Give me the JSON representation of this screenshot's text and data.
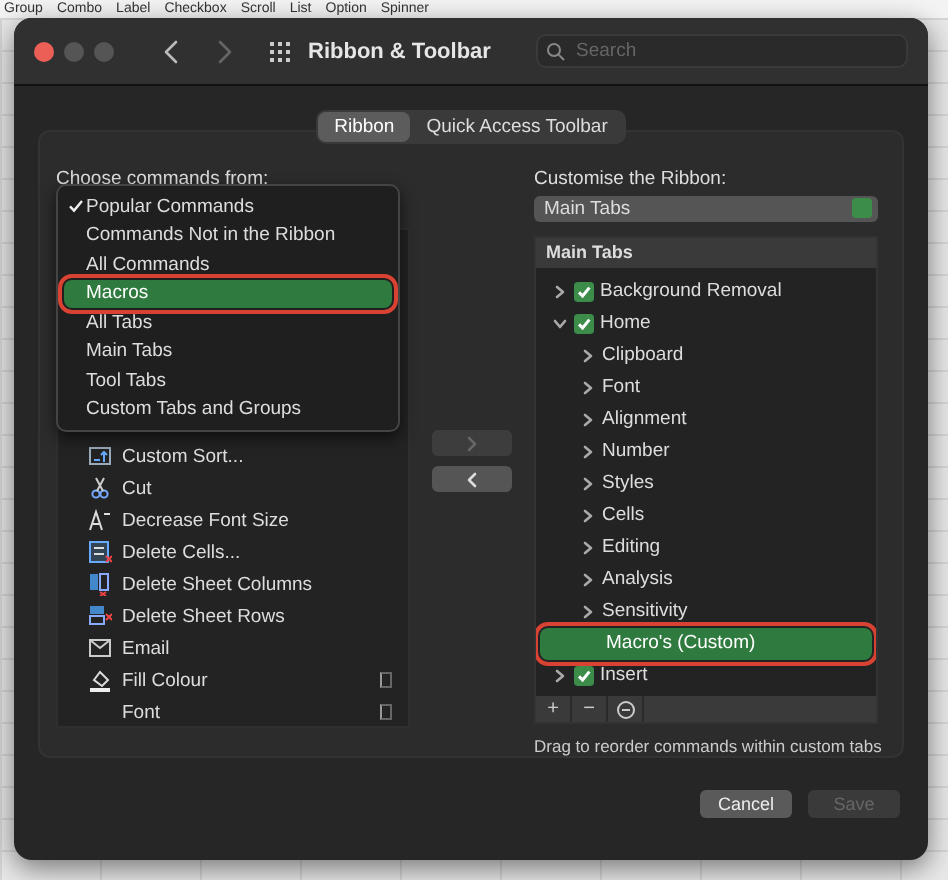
{
  "background_toolbar": [
    "Group",
    "Combo",
    "Label",
    "Checkbox",
    "Scroll",
    "List",
    "Option",
    "Spinner"
  ],
  "window": {
    "title": "Ribbon & Toolbar",
    "search": {
      "placeholder": "Search"
    }
  },
  "tabs": [
    {
      "label": "Ribbon",
      "selected": true
    },
    {
      "label": "Quick Access Toolbar",
      "selected": false
    }
  ],
  "commands": {
    "label": "Choose commands from:",
    "menu": [
      {
        "label": "Popular Commands",
        "checked": true,
        "selected": false,
        "outlined": false
      },
      {
        "label": "Commands Not in the Ribbon",
        "checked": false,
        "selected": false,
        "outlined": false
      },
      {
        "label": "All Commands",
        "checked": false,
        "selected": false,
        "outlined": false
      },
      {
        "label": "Macros",
        "checked": false,
        "selected": true,
        "outlined": true
      },
      {
        "label": "All Tabs",
        "checked": false,
        "selected": false,
        "outlined": false
      },
      {
        "label": "Main Tabs",
        "checked": false,
        "selected": false,
        "outlined": false
      },
      {
        "label": "Tool Tabs",
        "checked": false,
        "selected": false,
        "outlined": false
      },
      {
        "label": "Custom Tabs and Groups",
        "checked": false,
        "selected": false,
        "outlined": false
      }
    ],
    "items": [
      {
        "label": "Custom Sort...",
        "submenu": false
      },
      {
        "label": "Cut",
        "submenu": false
      },
      {
        "label": "Decrease Font Size",
        "submenu": false
      },
      {
        "label": "Delete Cells...",
        "submenu": false
      },
      {
        "label": "Delete Sheet Columns",
        "submenu": false
      },
      {
        "label": "Delete Sheet Rows",
        "submenu": false
      },
      {
        "label": "Email",
        "submenu": false
      },
      {
        "label": "Fill Colour",
        "submenu": true
      },
      {
        "label": "Font",
        "submenu": true
      }
    ]
  },
  "move_buttons": [
    {
      "disabled": true
    },
    {
      "disabled": false
    }
  ],
  "ribbon": {
    "label": "Customise the Ribbon:",
    "combo": "Main Tabs",
    "header": "Main Tabs",
    "items": [
      {
        "label": "Background Removal",
        "checked": true,
        "expanded": false,
        "selected": false,
        "outlined": false
      },
      {
        "label": "Home",
        "checked": true,
        "expanded": true,
        "selected": false,
        "outlined": false,
        "children": [
          {
            "label": "Clipboard",
            "expanded": false,
            "selected": false,
            "outlined": false
          },
          {
            "label": "Font",
            "expanded": false,
            "selected": false,
            "outlined": false
          },
          {
            "label": "Alignment",
            "expanded": false,
            "selected": false,
            "outlined": false
          },
          {
            "label": "Number",
            "expanded": false,
            "selected": false,
            "outlined": false
          },
          {
            "label": "Styles",
            "expanded": false,
            "selected": false,
            "outlined": false
          },
          {
            "label": "Cells",
            "expanded": false,
            "selected": false,
            "outlined": false
          },
          {
            "label": "Editing",
            "expanded": false,
            "selected": false,
            "outlined": false
          },
          {
            "label": "Analysis",
            "expanded": false,
            "selected": false,
            "outlined": false
          },
          {
            "label": "Sensitivity",
            "expanded": false,
            "selected": false,
            "outlined": false
          },
          {
            "label": "Macro's (Custom)",
            "selected": true,
            "outlined": true
          }
        ]
      },
      {
        "label": "Insert",
        "checked": true,
        "expanded": false,
        "selected": false,
        "outlined": false
      }
    ],
    "tool_buttons": [
      "+",
      "−"
    ],
    "hint": "Drag to reorder commands within custom tabs"
  },
  "buttons": [
    {
      "label": "Cancel",
      "disabled": false
    },
    {
      "label": "Save",
      "disabled": true
    }
  ]
}
